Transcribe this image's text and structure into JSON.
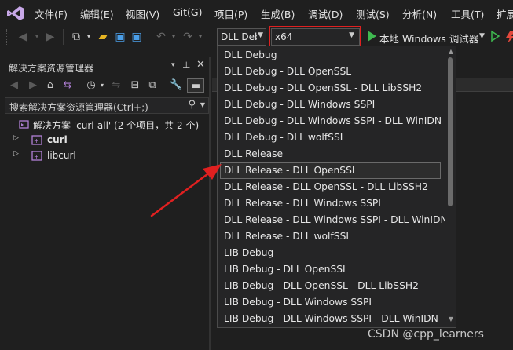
{
  "menu": {
    "items": [
      "文件(F)",
      "编辑(E)",
      "视图(V)",
      "Git(G)",
      "项目(P)",
      "生成(B)",
      "调试(D)",
      "测试(S)",
      "分析(N)",
      "工具(T)",
      "扩展"
    ]
  },
  "toolbar": {
    "config_value": "DLL Deb",
    "platform_value": "x64",
    "run_label": "本地 Windows 调试器"
  },
  "solution_explorer": {
    "title": "解决方案资源管理器",
    "search_placeholder": "搜索解决方案资源管理器(Ctrl+;)",
    "solution_label": "解决方案 'curl-all' (2 个项目，共 2 个)",
    "projects": [
      "curl",
      "libcurl"
    ]
  },
  "config_dropdown": {
    "options": [
      "DLL Debug",
      "DLL Debug - DLL OpenSSL",
      "DLL Debug - DLL OpenSSL - DLL LibSSH2",
      "DLL Debug - DLL Windows SSPI",
      "DLL Debug - DLL Windows SSPI - DLL WinIDN",
      "DLL Debug - DLL wolfSSL",
      "DLL Release",
      "DLL Release - DLL OpenSSL",
      "DLL Release - DLL OpenSSL - DLL LibSSH2",
      "DLL Release - DLL Windows SSPI",
      "DLL Release - DLL Windows SSPI - DLL WinIDN",
      "DLL Release - DLL wolfSSL",
      "LIB Debug",
      "LIB Debug - DLL OpenSSL",
      "LIB Debug - DLL OpenSSL - DLL LibSSH2",
      "LIB Debug - DLL Windows SSPI",
      "LIB Debug - DLL Windows SSPI - DLL WinIDN"
    ],
    "highlighted": "DLL Release - DLL OpenSSL"
  },
  "colors": {
    "background": "#1f1f1f",
    "dropdown_bg": "#252526",
    "highlight_red": "#e02020",
    "run_green": "#3fb950",
    "vs_purple": "#b180d7"
  },
  "watermark": "CSDN @cpp_learners"
}
